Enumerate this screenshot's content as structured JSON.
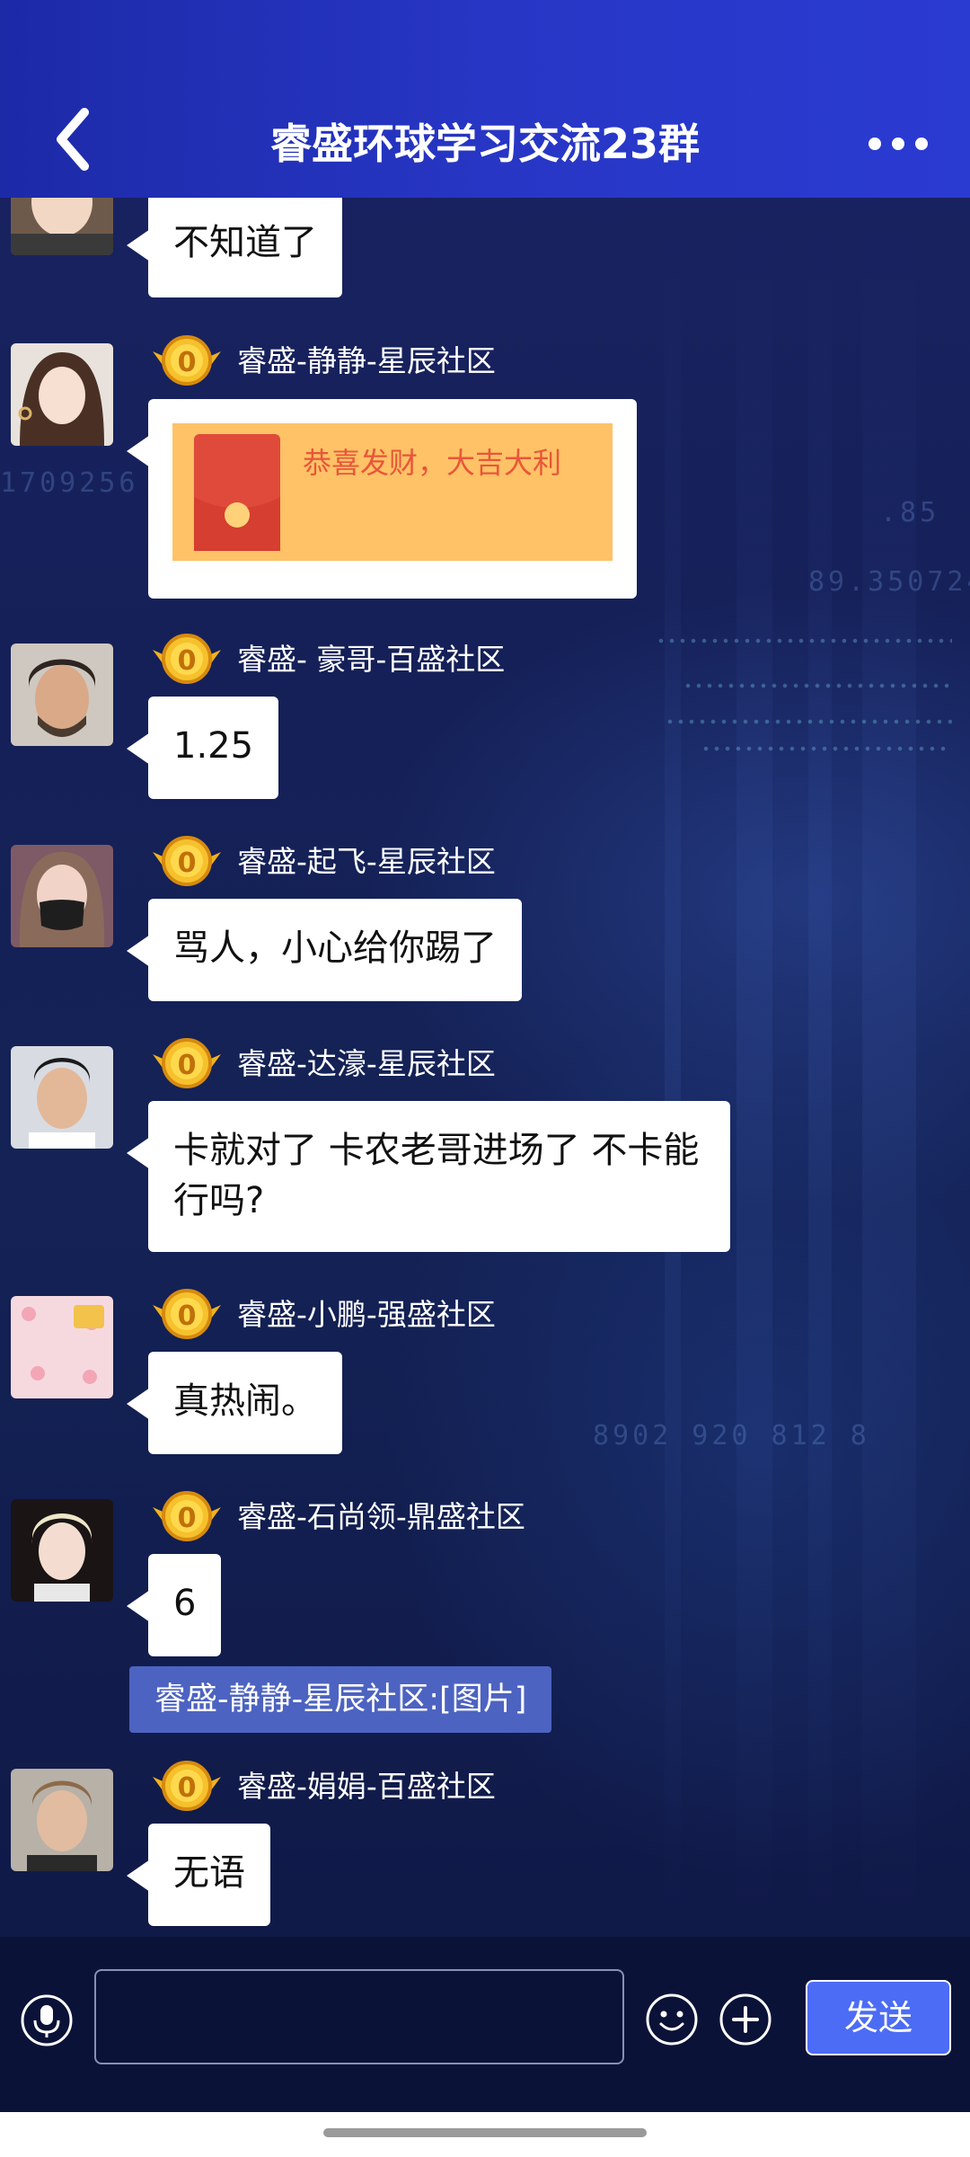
{
  "header": {
    "title": "睿盛环球学习交流23群",
    "back_icon": "chevron-left-icon",
    "more_icon": "more-horizontal-icon"
  },
  "messages": [
    {
      "sender": "",
      "text": "不知道了"
    },
    {
      "sender": "睿盛-静静-星辰社区",
      "type": "red-packet",
      "text": "恭喜发财，大吉大利"
    },
    {
      "sender": "睿盛- 豪哥-百盛社区",
      "text": "1.25"
    },
    {
      "sender": "睿盛-起飞-星辰社区",
      "text": "骂人，小心给你踢了"
    },
    {
      "sender": "睿盛-达濠-星辰社区",
      "text": "卡就对了 卡农老哥进场了 不卡能行吗?"
    },
    {
      "sender": "睿盛-小鹏-强盛社区",
      "text": "真热闹。"
    },
    {
      "sender": "睿盛-石尚领-鼎盛社区",
      "text": "6"
    },
    {
      "type": "notice",
      "text": "睿盛-静静-星辰社区:[图片]"
    },
    {
      "sender": "睿盛-娟娟-百盛社区",
      "text": "无语"
    }
  ],
  "badge": {
    "label": "0",
    "icon": "gold-medal-icon"
  },
  "input_bar": {
    "voice_icon": "microphone-icon",
    "input_value": "",
    "input_placeholder": "",
    "emoji_icon": "smile-icon",
    "plus_icon": "plus-circle-icon",
    "send_label": "发送"
  },
  "colors": {
    "header": "#2736c4",
    "bubble": "#ffffff",
    "red_packet": "#ffc266",
    "red_packet_text": "#e8563a",
    "notice": "#4d63c1",
    "send_button": "#4d6cf5"
  }
}
